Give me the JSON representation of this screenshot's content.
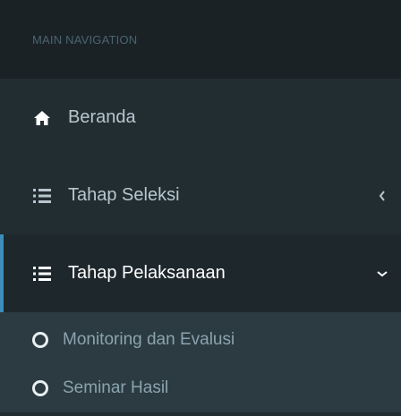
{
  "sidebar": {
    "header": "MAIN NAVIGATION",
    "items": [
      {
        "label": "Beranda",
        "icon": "home-icon"
      },
      {
        "label": "Tahap Seleksi",
        "icon": "list-icon",
        "chevron": "chevron-left-icon"
      },
      {
        "label": "Tahap Pelaksanaan",
        "icon": "list-icon",
        "chevron": "chevron-down-icon",
        "active": true
      }
    ],
    "submenu": [
      {
        "label": "Monitoring dan Evalusi",
        "icon": "circle-outline-icon"
      },
      {
        "label": "Seminar Hasil",
        "icon": "circle-outline-icon"
      }
    ]
  },
  "colors": {
    "sidebar_bg": "#222d32",
    "header_bg": "#1a2226",
    "active_bg": "#1e282c",
    "submenu_bg": "#2c3b41",
    "accent": "#3c8dbc",
    "text": "#b8c7ce",
    "active_text": "#ffffff"
  }
}
